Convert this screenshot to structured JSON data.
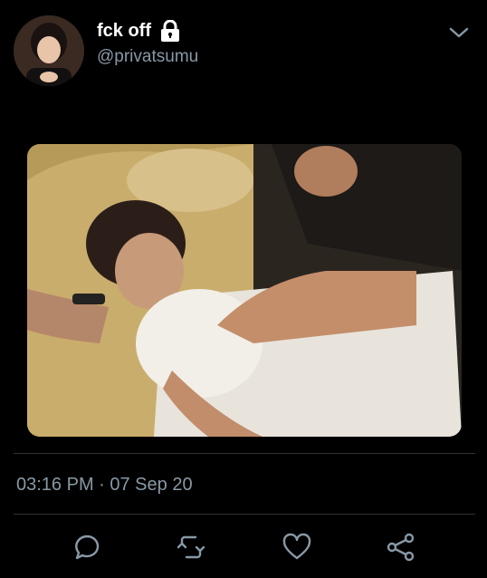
{
  "tweet": {
    "display_name": "fck off",
    "handle": "@privatsumu",
    "timestamp": "03:16 PM · 07 Sep 20"
  },
  "icons": {
    "lock": "lock-icon",
    "menu": "chevron-down-icon",
    "reply": "reply-icon",
    "retweet": "retweet-icon",
    "like": "heart-icon",
    "share": "share-icon"
  },
  "colors": {
    "background": "#000000",
    "secondary_text": "#8899a6",
    "icon": "#8899a6",
    "divider": "#2f3336"
  }
}
